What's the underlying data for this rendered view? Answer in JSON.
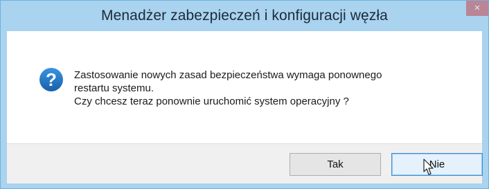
{
  "dialog": {
    "title": "Menadżer zabezpieczeń i konfiguracji węzła",
    "close_label": "×",
    "message_lines": [
      "Zastosowanie nowych zasad bezpieczeństwa wymaga ponownego",
      "restartu systemu.",
      "Czy chcesz teraz ponownie uruchomić system operacyjny ?"
    ],
    "icon": "question-icon",
    "buttons": {
      "yes_label": "Tak",
      "no_label": "Nie"
    },
    "colors": {
      "frame": "#a9d3ef",
      "icon": "#1f73c4",
      "focused_button_border": "#3c8fd6"
    }
  }
}
